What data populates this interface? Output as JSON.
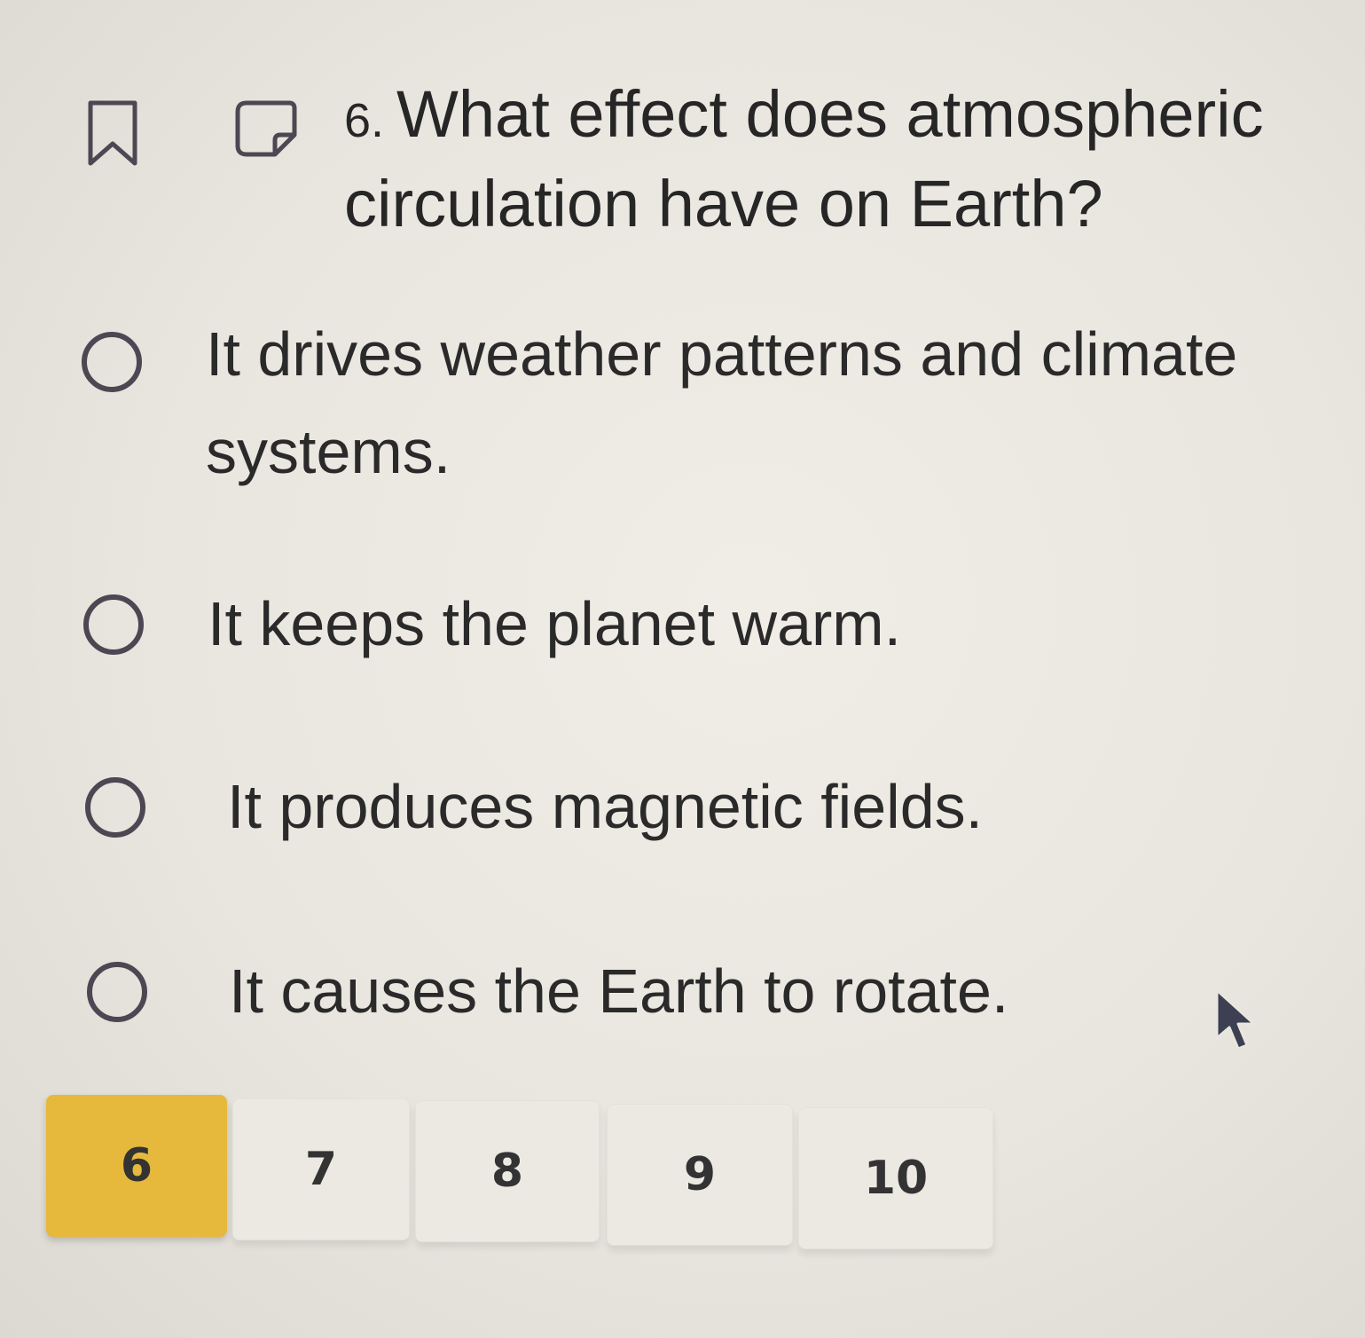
{
  "question": {
    "number": "6.",
    "text": "What effect does atmospheric circulation have on Earth?"
  },
  "toolbar": {
    "bookmark_icon": "bookmark-icon",
    "note_icon": "note-icon"
  },
  "options": [
    {
      "label": "It drives weather patterns and climate systems.",
      "selected": false
    },
    {
      "label": "It keeps the planet warm.",
      "selected": false
    },
    {
      "label": "It produces magnetic fields.",
      "selected": false
    },
    {
      "label": "It causes the Earth to rotate.",
      "selected": false
    }
  ],
  "pagination": {
    "pages": [
      "6",
      "7",
      "8",
      "9",
      "10"
    ],
    "current": "6",
    "active_color": "#e6b83c"
  },
  "cursor_icon": "arrow-cursor-icon"
}
